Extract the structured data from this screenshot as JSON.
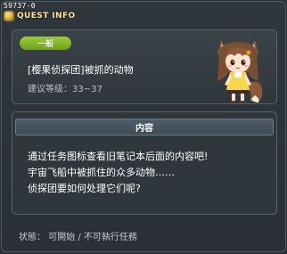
{
  "window": {
    "quest_id": "59737-0",
    "title": "QUEST INFO"
  },
  "quest": {
    "category_badge": "一般",
    "name": "[樱果侦探团]被抓的动物",
    "level_label": "建议等级：33~37"
  },
  "content": {
    "header": "内容",
    "lines": [
      "通过任务图标查看旧笔记本后面的内容吧!",
      "宇宙飞船中被抓住的众多动物……",
      "侦探团要如何处理它们呢?"
    ]
  },
  "status": {
    "text": "状態： 可開始 / 不可執行任務"
  },
  "colors": {
    "badge_green": "#8bc034",
    "title_gold": "#ffe79c",
    "panel_bg": "#30373c"
  }
}
